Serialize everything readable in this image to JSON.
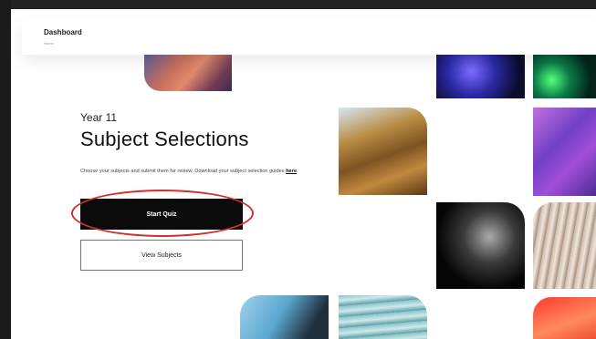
{
  "header": {
    "title": "Dashboard",
    "breadcrumb": "Home"
  },
  "hero": {
    "year_label": "Year 11",
    "title": "Subject Selections",
    "description_text": "Choose your subjects and submit them for review. Download your subject selection guides ",
    "description_link": "here",
    "description_suffix": "."
  },
  "buttons": {
    "start_quiz": "Start Quiz",
    "view_subjects": "View Subjects"
  },
  "colors": {
    "primary_button": "#0b0b0b",
    "annotation_circle": "#d0312d"
  }
}
